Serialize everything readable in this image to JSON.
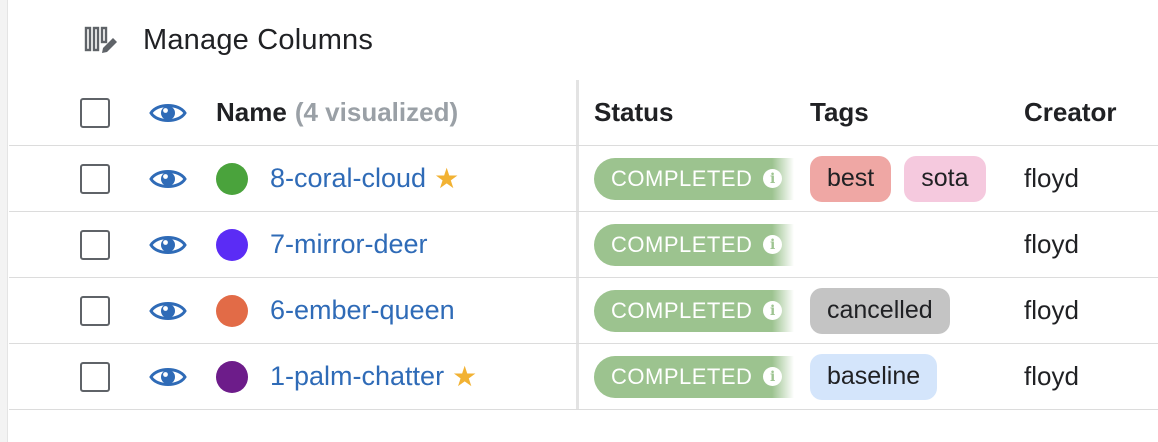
{
  "toolbar": {
    "manage_columns_label": "Manage Columns",
    "manage_columns_icon": "columns-edit-icon"
  },
  "table": {
    "headers": {
      "name": "Name",
      "name_sub": "(4 visualized)",
      "status": "Status",
      "tags": "Tags",
      "creator": "Creator"
    },
    "rows": [
      {
        "name": "8-coral-cloud",
        "color": "#4aa33c",
        "starred": true,
        "star": "★",
        "status": "COMPLETED",
        "tags": [
          {
            "label": "best",
            "bg": "#efa7a4"
          },
          {
            "label": "sota",
            "bg": "#f5c9de"
          }
        ],
        "creator": "floyd"
      },
      {
        "name": "7-mirror-deer",
        "color": "#5b2cf5",
        "starred": false,
        "star": "",
        "status": "COMPLETED",
        "tags": [],
        "creator": "floyd"
      },
      {
        "name": "6-ember-queen",
        "color": "#e26b47",
        "starred": false,
        "star": "",
        "status": "COMPLETED",
        "tags": [
          {
            "label": "cancelled",
            "bg": "#c4c4c4"
          }
        ],
        "creator": "floyd"
      },
      {
        "name": "1-palm-chatter",
        "color": "#6d1c8a",
        "starred": true,
        "star": "★",
        "status": "COMPLETED",
        "tags": [
          {
            "label": "baseline",
            "bg": "#d4e5fb"
          }
        ],
        "creator": "floyd"
      }
    ]
  },
  "colors": {
    "link": "#2f6bb7",
    "status_completed": "#9cc38f",
    "star": "#f2b233",
    "eye": "#2f6bb7"
  }
}
